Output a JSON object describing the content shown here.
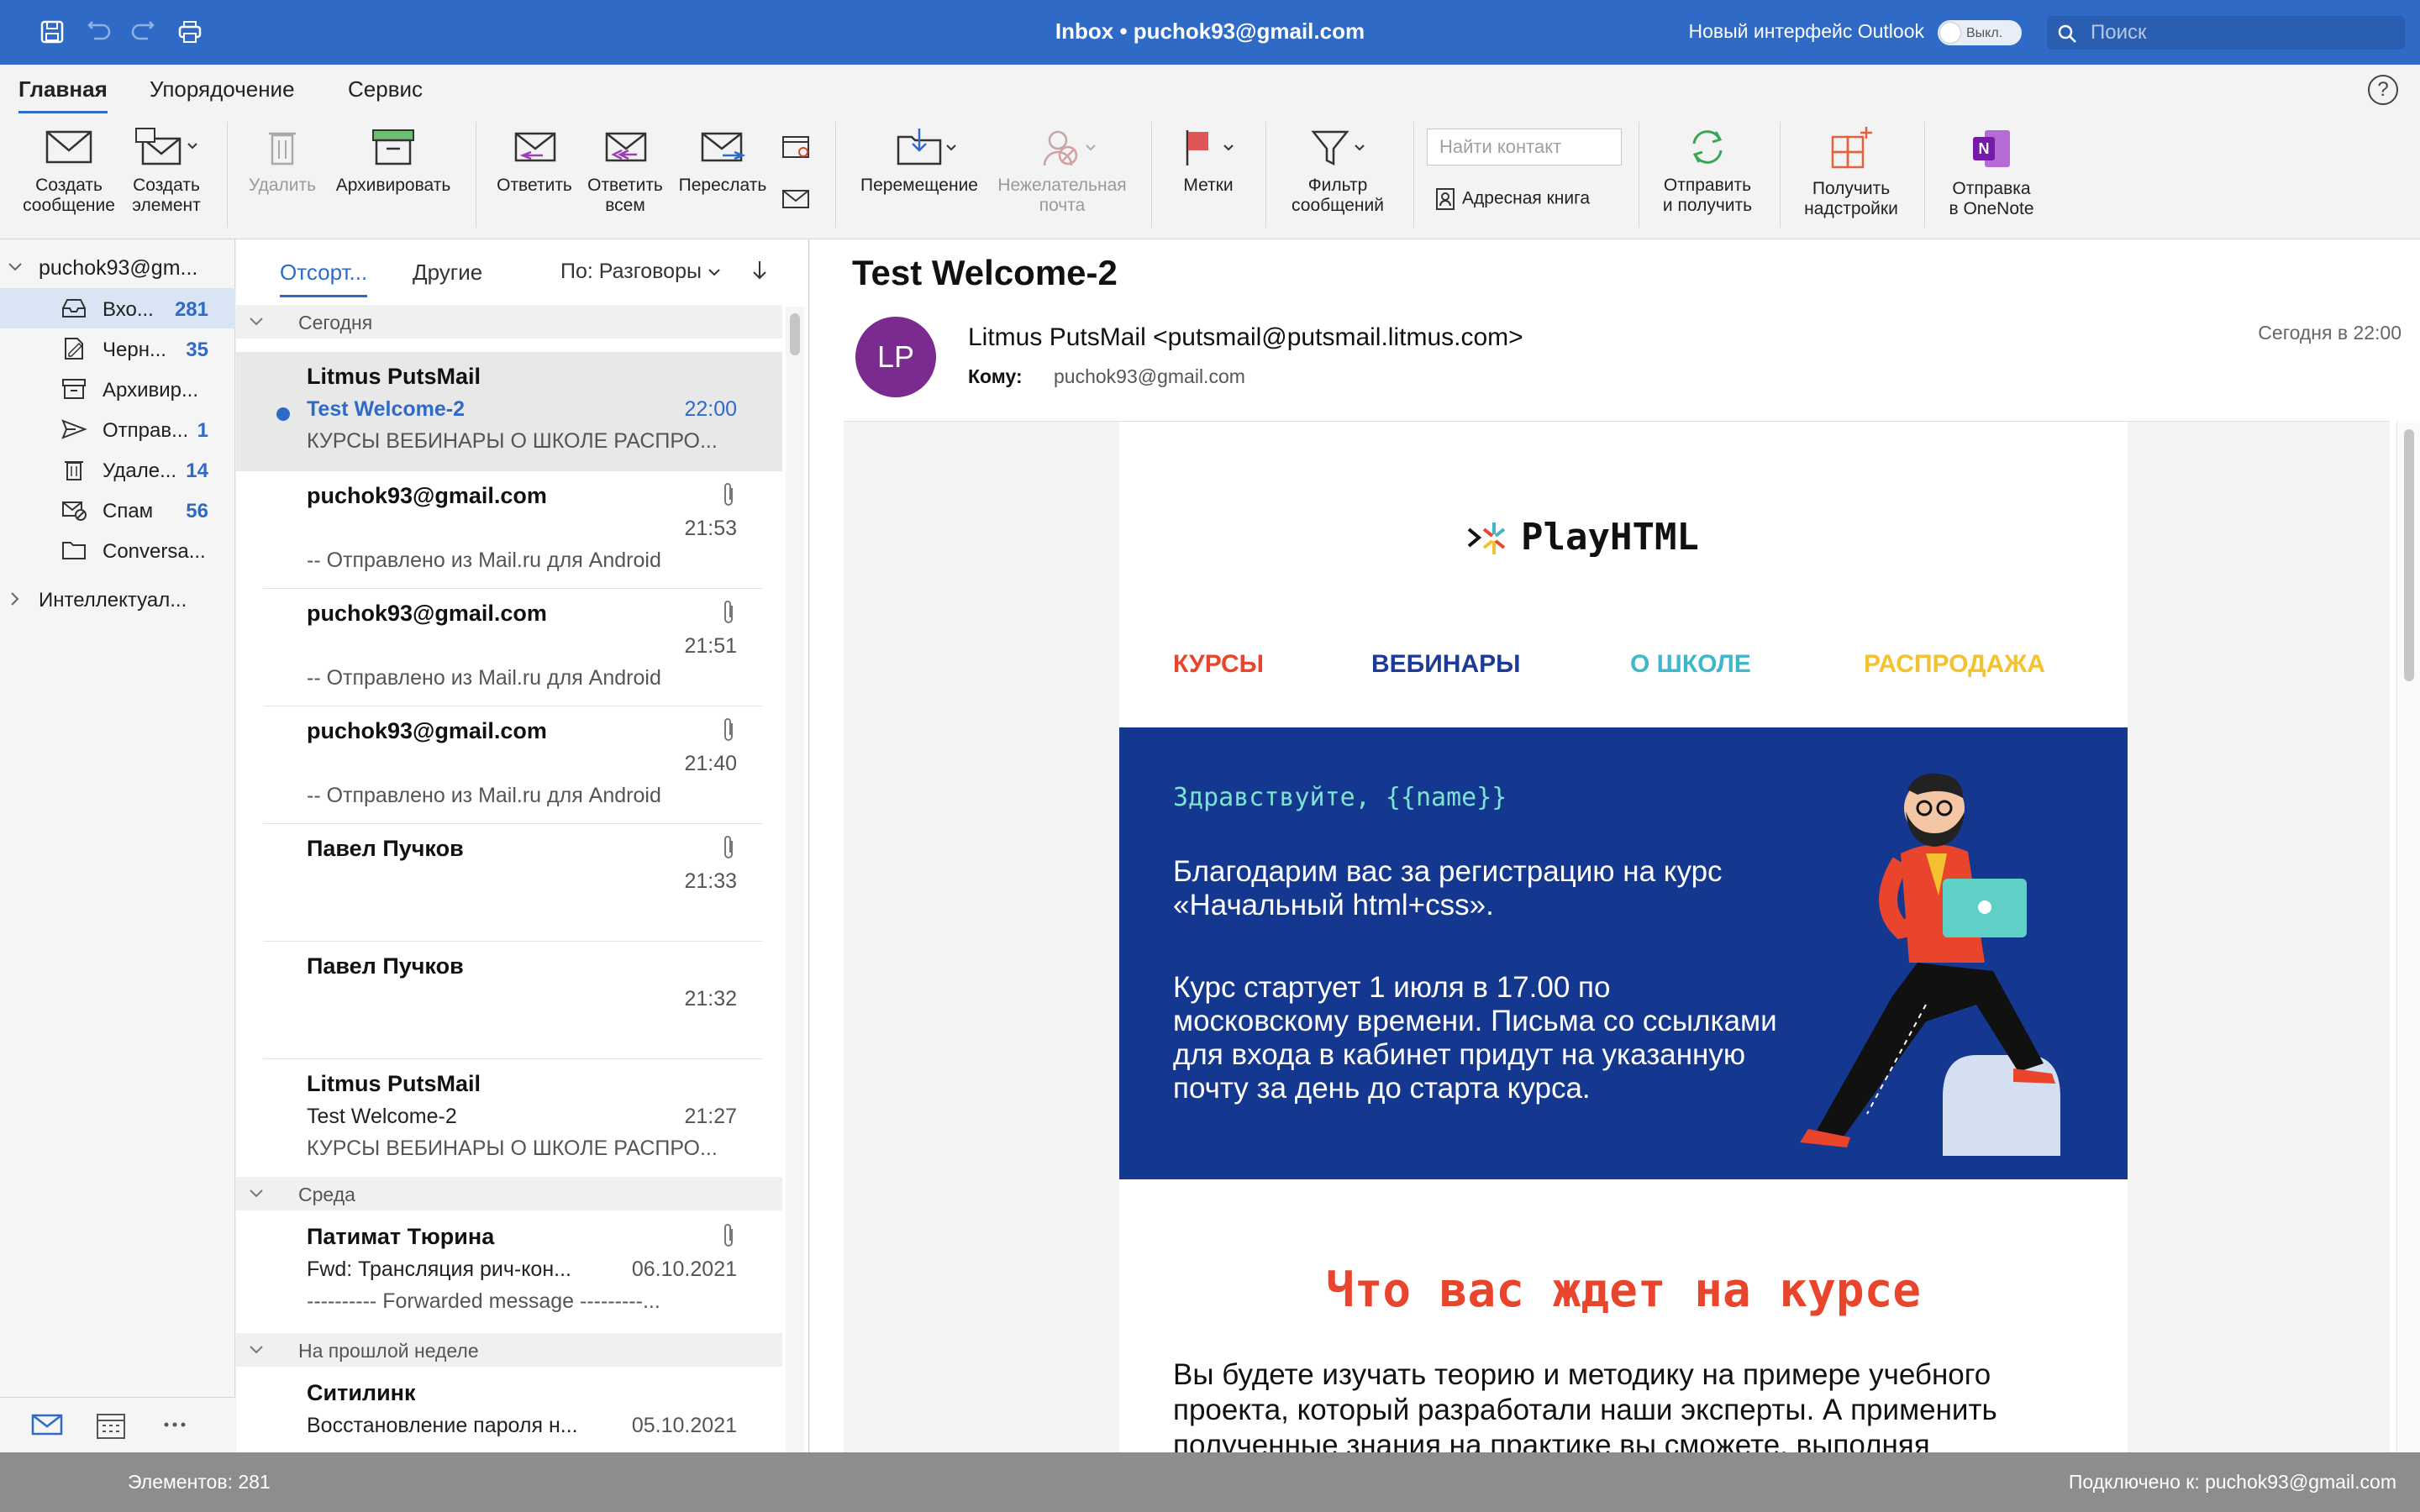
{
  "window": {
    "title": "Inbox • puchok93@gmail.com",
    "new_outlook_label": "Новый интерфейс Outlook",
    "toggle_label": "Выкл.",
    "search_placeholder": "Поиск"
  },
  "ribbon_tabs": [
    "Главная",
    "Упорядочение",
    "Сервис"
  ],
  "ribbon": {
    "new_message": [
      "Создать",
      "сообщение"
    ],
    "new_item": [
      "Создать",
      "элемент"
    ],
    "delete": "Удалить",
    "archive": "Архивировать",
    "reply": "Ответить",
    "reply_all": [
      "Ответить",
      "всем"
    ],
    "forward": "Переслать",
    "move": "Перемещение",
    "junk": [
      "Нежелательная",
      "почта"
    ],
    "flags": "Метки",
    "filter": [
      "Фильтр",
      "сообщений"
    ],
    "find_contact_placeholder": "Найти контакт",
    "address_book": "Адресная книга",
    "send_receive": [
      "Отправить",
      "и получить"
    ],
    "get_addins": [
      "Получить",
      "надстройки"
    ],
    "onenote": [
      "Отправка",
      "в OneNote"
    ]
  },
  "folders": {
    "account": "puchok93@gm...",
    "items": [
      {
        "name": "Вхо...",
        "count": "281"
      },
      {
        "name": "Черн...",
        "count": "35"
      },
      {
        "name": "Архивир...",
        "count": ""
      },
      {
        "name": "Отправ...",
        "count": "1"
      },
      {
        "name": "Удале...",
        "count": "14"
      },
      {
        "name": "Спам",
        "count": "56"
      },
      {
        "name": "Conversa...",
        "count": ""
      }
    ],
    "smart": "Интеллектуал..."
  },
  "message_list": {
    "tabs": [
      "Отсорт...",
      "Другие"
    ],
    "sort_label": "По: Разговоры",
    "groups": [
      "Сегодня",
      "Среда",
      "На прошлой неделе"
    ],
    "messages": [
      {
        "from": "Litmus PutsMail",
        "subject": "Test Welcome-2",
        "time": "22:00",
        "preview": "КУРСЫ ВЕБИНАРЫ О ШКОЛЕ РАСПРО..."
      },
      {
        "from": "puchok93@gmail.com",
        "subject": "",
        "time": "21:53",
        "preview": "-- Отправлено из Mail.ru для Android"
      },
      {
        "from": "puchok93@gmail.com",
        "subject": "",
        "time": "21:51",
        "preview": "-- Отправлено из Mail.ru для Android"
      },
      {
        "from": "puchok93@gmail.com",
        "subject": "",
        "time": "21:40",
        "preview": "-- Отправлено из Mail.ru для Android"
      },
      {
        "from": "Павел Пучков",
        "subject": "",
        "time": "21:33",
        "preview": ""
      },
      {
        "from": "Павел Пучков",
        "subject": "",
        "time": "21:32",
        "preview": ""
      },
      {
        "from": "Litmus PutsMail",
        "subject": "Test Welcome-2",
        "time": "21:27",
        "preview": "КУРСЫ ВЕБИНАРЫ О ШКОЛЕ РАСПРО..."
      },
      {
        "from": "Патимат Тюрина",
        "subject": "Fwd: Трансляция рич-кон...",
        "time": "06.10.2021",
        "preview": "---------- Forwarded message ---------..."
      },
      {
        "from": "Ситилинк",
        "subject": "Восстановление пароля н...",
        "time": "05.10.2021",
        "preview": ""
      }
    ]
  },
  "reading": {
    "subject": "Test Welcome-2",
    "avatar": "LP",
    "from": "Litmus PutsMail <putsmail@putsmail.litmus.com>",
    "to_label": "Кому:",
    "to": "puchok93@gmail.com",
    "date": "Сегодня в 22:00",
    "email": {
      "logo": "PlayHTML",
      "nav": [
        "КУРСЫ",
        "ВЕБИНАРЫ",
        "О ШКОЛЕ",
        "РАСПРОДАЖА"
      ],
      "nav_colors": [
        "#e8452c",
        "#1d3a96",
        "#3fb6c9",
        "#f2c230"
      ],
      "greeting": "Здравствуйте, {{name}}",
      "para1": "Благодарим вас за регистрацию на курс «Начальный html+css».",
      "para2": "Курс стартует 1 июля в 17.00 по московскому времени. Письма со ссылками для входа в кабинет придут на указанную почту за день до старта курса.",
      "section_title": "Что вас ждет на курсе",
      "section_text": "Вы будете изучать теорию и методику на примере учебного проекта, который разработали наши эксперты. А применить полученные знания на практике вы сможете, выполняя"
    }
  },
  "status": {
    "items": "Элементов: 281",
    "connected": "Подключено к: puchok93@gmail.com"
  }
}
